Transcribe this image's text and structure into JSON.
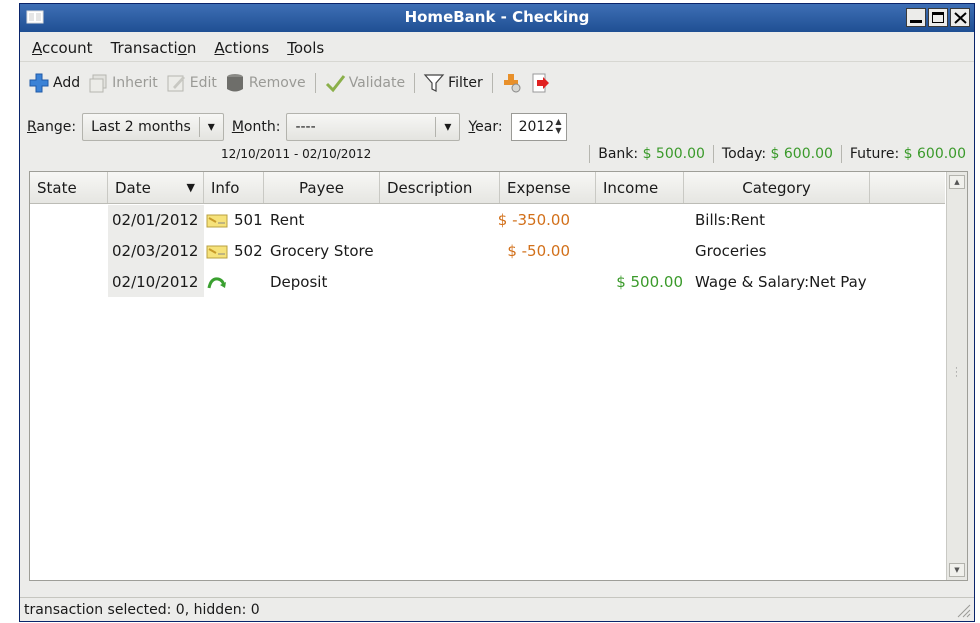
{
  "window": {
    "title": "HomeBank - Checking"
  },
  "menu": [
    {
      "prefix": "",
      "u": "A",
      "rest": "ccount"
    },
    {
      "prefix": "Transacti",
      "u": "o",
      "rest": "n"
    },
    {
      "prefix": "",
      "u": "A",
      "rest": "ctions"
    },
    {
      "prefix": "",
      "u": "T",
      "rest": "ools"
    }
  ],
  "toolbar": {
    "add": "Add",
    "inherit": "Inherit",
    "edit": "Edit",
    "remove": "Remove",
    "validate": "Validate",
    "filter": "Filter"
  },
  "range": {
    "range_label_u": "R",
    "range_label_rest": "ange:",
    "range_value": "Last 2 months",
    "month_label_u": "M",
    "month_label_rest": "onth:",
    "month_value": "----",
    "year_label_u": "Y",
    "year_label_rest": "ear:",
    "year_value": "2012",
    "date_range": "12/10/2011 - 02/10/2012"
  },
  "balances": {
    "bank_label": "Bank:",
    "bank_value": "$ 500.00",
    "today_label": "Today:",
    "today_value": "$ 600.00",
    "future_label": "Future:",
    "future_value": "$ 600.00"
  },
  "columns": {
    "state": "State",
    "date": "Date",
    "info": "Info",
    "payee": "Payee",
    "description": "Description",
    "expense": "Expense",
    "income": "Income",
    "category": "Category"
  },
  "transactions": [
    {
      "date": "02/01/2012",
      "info": "501",
      "payee": "Rent",
      "expense": "$ -350.00",
      "income": "",
      "category": "Bills:Rent"
    },
    {
      "date": "02/03/2012",
      "info": "502",
      "payee": "Grocery Store",
      "expense": "$ -50.00",
      "income": "",
      "category": "Groceries"
    },
    {
      "date": "02/10/2012",
      "info": "",
      "payee": "Deposit",
      "expense": "",
      "income": "$ 500.00",
      "category": "Wage & Salary:Net Pay"
    }
  ],
  "status": {
    "text": "transaction selected: 0, hidden: 0"
  },
  "colors": {
    "positive": "#3a9a2a",
    "negative": "#d2701a",
    "titlebar": "#2a5aa0"
  }
}
